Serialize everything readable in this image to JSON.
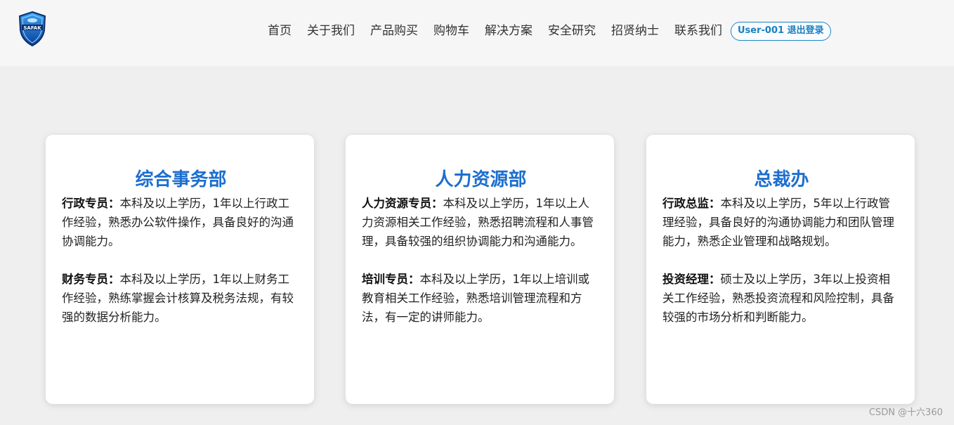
{
  "nav": {
    "items": [
      "首页",
      "关于我们",
      "产品购买",
      "购物车",
      "解决方案",
      "安全研究",
      "招贤纳士",
      "联系我们"
    ],
    "user_button": "User-001 退出登录"
  },
  "logo": {
    "icon": "shield-logo-icon",
    "text": "SAFAK"
  },
  "departments": [
    {
      "title": "综合事务部",
      "jobs": [
        {
          "role": "行政专员：",
          "desc": "本科及以上学历，1年以上行政工作经验，熟悉办公软件操作，具备良好的沟通协调能力。"
        },
        {
          "role": "财务专员：",
          "desc": "本科及以上学历，1年以上财务工作经验，熟练掌握会计核算及税务法规，有较强的数据分析能力。"
        }
      ]
    },
    {
      "title": "人力资源部",
      "jobs": [
        {
          "role": "人力资源专员：",
          "desc": "本科及以上学历，1年以上人力资源相关工作经验，熟悉招聘流程和人事管理，具备较强的组织协调能力和沟通能力。"
        },
        {
          "role": "培训专员：",
          "desc": "本科及以上学历，1年以上培训或教育相关工作经验，熟悉培训管理流程和方法，有一定的讲师能力。"
        }
      ]
    },
    {
      "title": "总裁办",
      "jobs": [
        {
          "role": "行政总监：",
          "desc": "本科及以上学历，5年以上行政管理经验，具备良好的沟通协调能力和团队管理能力，熟悉企业管理和战略规划。"
        },
        {
          "role": "投资经理：",
          "desc": "硕士及以上学历，3年以上投资相关工作经验，熟悉投资流程和风险控制，具备较强的市场分析和判断能力。"
        }
      ]
    }
  ],
  "watermark": "CSDN @十六360",
  "colors": {
    "accent": "#1d6fcf",
    "button_border": "#1a86c9",
    "page_bg": "#efefef"
  }
}
